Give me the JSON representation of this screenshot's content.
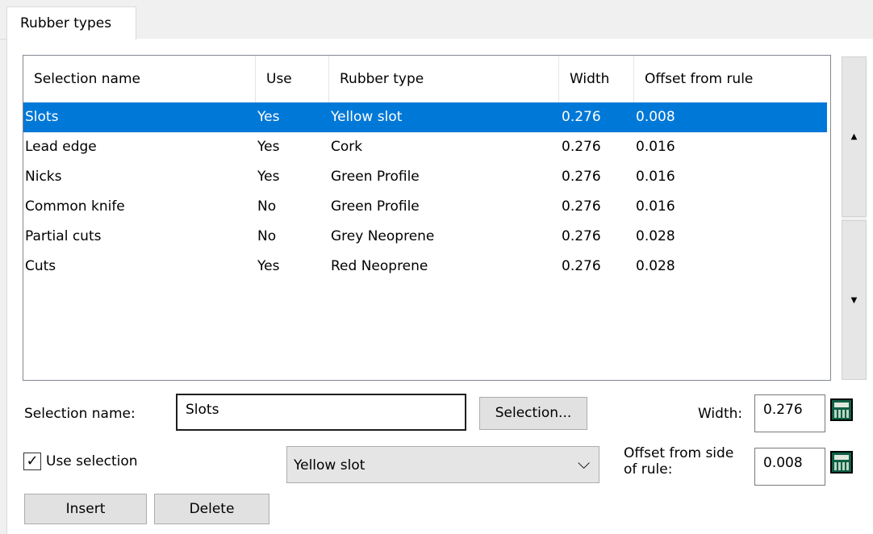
{
  "tab": {
    "label": "Rubber types"
  },
  "table": {
    "columns": [
      "Selection name",
      "Use",
      "Rubber type",
      "Width",
      "Offset from rule"
    ],
    "rows": [
      [
        "Slots",
        "Yes",
        "Yellow slot",
        "0.276",
        "0.008"
      ],
      [
        "Lead edge",
        "Yes",
        "Cork",
        "0.276",
        "0.016"
      ],
      [
        "Nicks",
        "Yes",
        "Green Profile",
        "0.276",
        "0.016"
      ],
      [
        "Common knife",
        "No",
        "Green Profile",
        "0.276",
        "0.016"
      ],
      [
        "Partial cuts",
        "No",
        "Grey Neoprene",
        "0.276",
        "0.028"
      ],
      [
        "Cuts",
        "Yes",
        "Red Neoprene",
        "0.276",
        "0.028"
      ]
    ],
    "selected_row": 0
  },
  "scrollbar": {
    "up_icon": "▲",
    "down_icon": "▼"
  },
  "form": {
    "selection_name_label": "Selection name:",
    "selection_name_value": "Slots",
    "selection_button": "Selection...",
    "width_label": "Width:",
    "width_value": "0.276",
    "use_selection_label": "Use selection",
    "use_selection_checked": "✓",
    "rubber_type_value": "Yellow slot",
    "dropdown_icon": "⌵",
    "offset_label_line1": "Offset from side",
    "offset_label_line2": "of rule:",
    "offset_value": "0.008",
    "insert_button": "Insert",
    "delete_button": "Delete"
  },
  "colors": {
    "selection_background": "#0078d7",
    "selection_text": "#ffffff",
    "calculator_icon": "#0f5f45"
  }
}
